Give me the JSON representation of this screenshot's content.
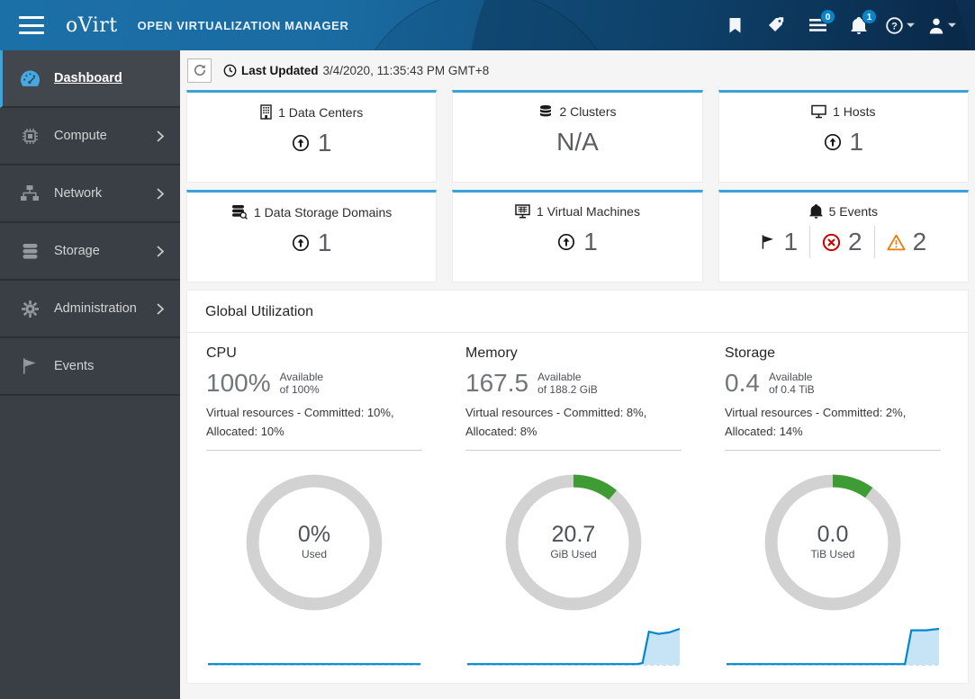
{
  "colors": {
    "accent_blue": "#39a5dc",
    "badge_blue": "#0b84c9",
    "donut_track": "#d2d2d2",
    "donut_used_green": "#3f9c35",
    "sparkline_blue": "#0088ce",
    "sparkline_fill": "#c6e4f5",
    "error_red": "#cc0000",
    "warning_orange": "#ec7a08"
  },
  "masthead": {
    "brand": "oVirt",
    "product": "OPEN VIRTUALIZATION MANAGER",
    "tasks_badge": "0",
    "notifications_badge": "1"
  },
  "sidebar": {
    "items": [
      {
        "label": "Dashboard"
      },
      {
        "label": "Compute"
      },
      {
        "label": "Network"
      },
      {
        "label": "Storage"
      },
      {
        "label": "Administration"
      },
      {
        "label": "Events"
      }
    ]
  },
  "refresh_bar": {
    "label": "Last Updated",
    "value": "3/4/2020, 11:35:43 PM GMT+8"
  },
  "cards": [
    {
      "label": "1 Data Centers",
      "value": "1"
    },
    {
      "label": "2 Clusters",
      "value": "N/A"
    },
    {
      "label": "1 Hosts",
      "value": "1"
    },
    {
      "label": "1 Data Storage Domains",
      "value": "1"
    },
    {
      "label": "1 Virtual Machines",
      "value": "1"
    },
    {
      "label": "5 Events",
      "flag_count": "1",
      "error_count": "2",
      "warning_count": "2"
    }
  ],
  "global_utilization": {
    "title": "Global Utilization",
    "cpu": {
      "title": "CPU",
      "available": "100%",
      "available_label": "Available",
      "of": "of 100%",
      "vr_line1": "Virtual resources - Committed: 10%,",
      "vr_line2": "Allocated: 10%",
      "donut_value": "0%",
      "donut_label": "Used",
      "donut": {
        "pct": 0
      },
      "sparkline": {
        "points": [
          [
            0,
            0.02
          ],
          [
            1,
            0.02
          ]
        ]
      }
    },
    "memory": {
      "title": "Memory",
      "available": "167.5",
      "available_label": "Available",
      "of": "of 188.2 GiB",
      "vr_line1": "Virtual resources - Committed: 8%,",
      "vr_line2": "Allocated: 8%",
      "donut_value": "20.7",
      "donut_label": "GiB Used",
      "donut": {
        "pct": 11
      },
      "sparkline": {
        "points": [
          [
            0,
            0.02
          ],
          [
            0.8,
            0.02
          ],
          [
            0.825,
            0.05
          ],
          [
            0.855,
            0.92
          ],
          [
            0.9,
            0.86
          ],
          [
            0.95,
            0.9
          ],
          [
            1,
            1
          ]
        ]
      }
    },
    "storage": {
      "title": "Storage",
      "available": "0.4",
      "available_label": "Available",
      "of": "of 0.4 TiB",
      "vr_line1": "Virtual resources - Committed: 2%,",
      "vr_line2": "Allocated: 14%",
      "donut_value": "0.0",
      "donut_label": "TiB Used",
      "donut": {
        "pct": 10
      },
      "sparkline": {
        "points": [
          [
            0,
            0.02
          ],
          [
            0.84,
            0.02
          ],
          [
            0.87,
            0.96
          ],
          [
            0.94,
            0.96
          ],
          [
            1,
            1
          ]
        ]
      }
    }
  }
}
